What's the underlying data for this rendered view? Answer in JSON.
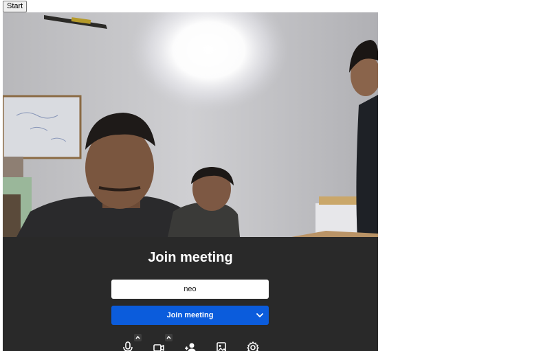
{
  "start_button": {
    "label": "Start"
  },
  "prejoin": {
    "title": "Join meeting",
    "name_input": {
      "value": "neo",
      "placeholder": ""
    },
    "join_button": {
      "label": "Join meeting"
    },
    "toolbar": [
      {
        "icon": "microphone-icon",
        "has_options_caret": true
      },
      {
        "icon": "camera-icon",
        "has_options_caret": true
      },
      {
        "icon": "invite-person-icon",
        "has_options_caret": false
      },
      {
        "icon": "virtual-background-icon",
        "has_options_caret": false
      },
      {
        "icon": "gear-icon",
        "has_options_caret": false
      }
    ]
  },
  "colors": {
    "panel_background": "#292929",
    "join_button": "#0b5cdc",
    "input_background": "#ffffff",
    "title_text": "#ffffff"
  }
}
